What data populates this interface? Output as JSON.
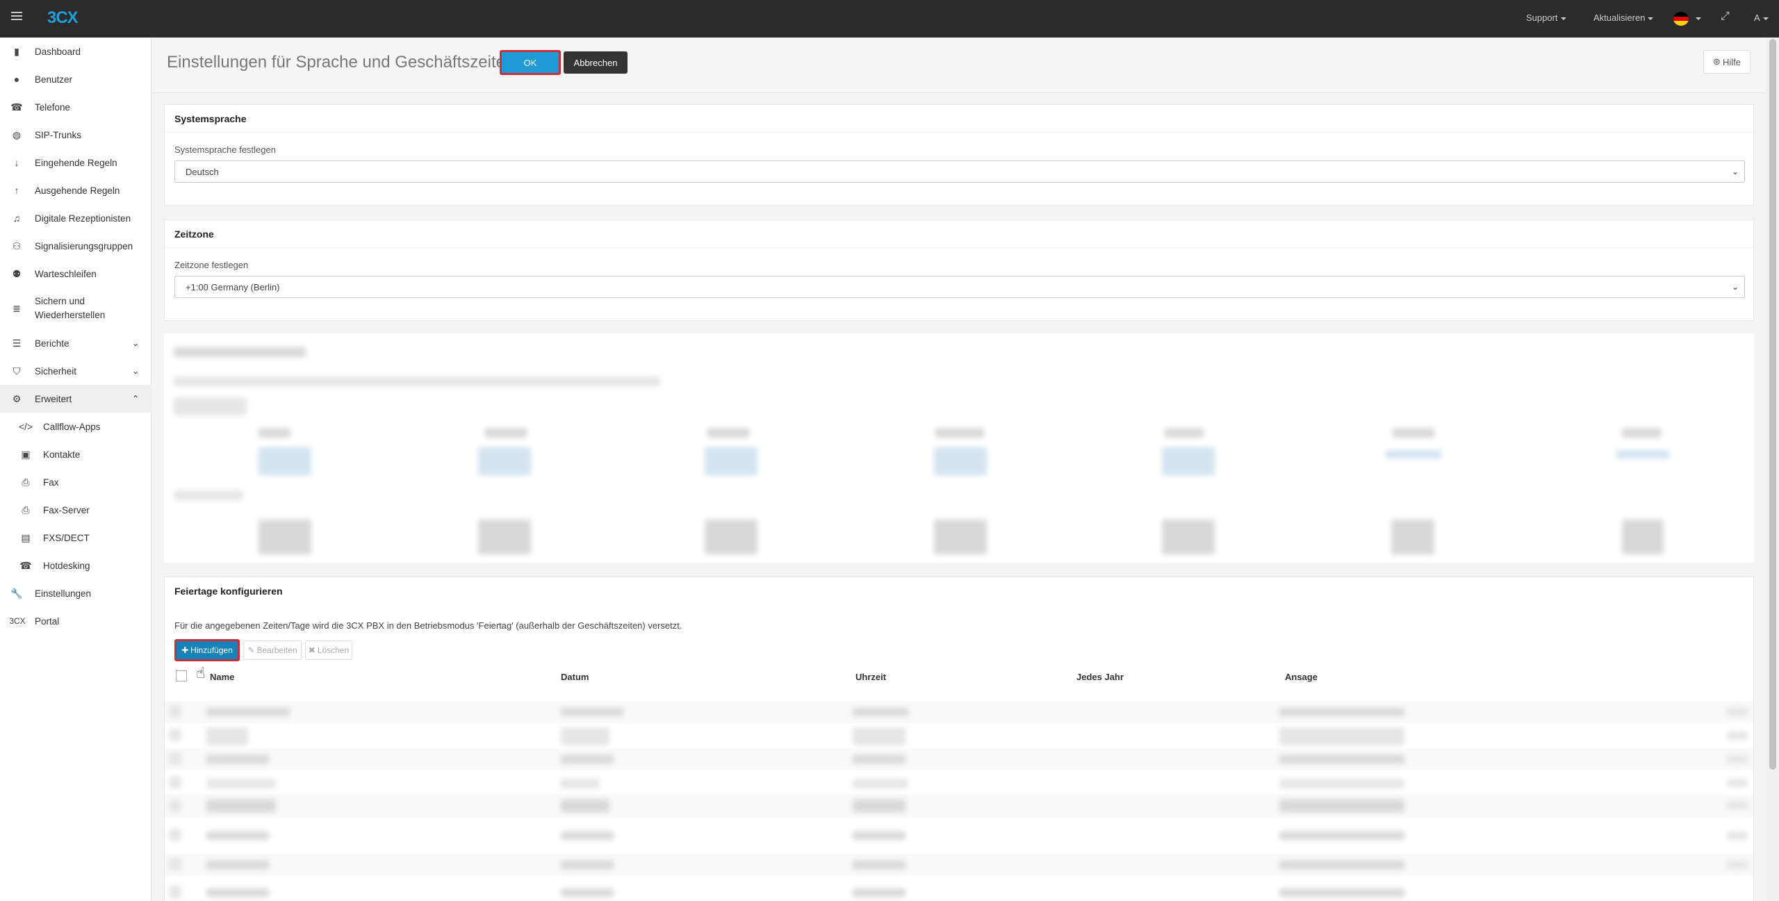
{
  "topbar": {
    "logo_main": "3CX",
    "support_label": "Support",
    "update_label": "Aktualisieren",
    "user_label": "A",
    "flag_colors": [
      "#000000",
      "#dd0000",
      "#ffce00"
    ]
  },
  "sidebar": {
    "items": [
      {
        "label": "Dashboard",
        "icon": "bar-chart-icon"
      },
      {
        "label": "Benutzer",
        "icon": "user-icon"
      },
      {
        "label": "Telefone",
        "icon": "phone-icon"
      },
      {
        "label": "SIP-Trunks",
        "icon": "globe-icon"
      },
      {
        "label": "Eingehende Regeln",
        "icon": "arrow-down-icon"
      },
      {
        "label": "Ausgehende Regeln",
        "icon": "arrow-up-icon"
      },
      {
        "label": "Digitale Rezeptionisten",
        "icon": "headset-icon"
      },
      {
        "label": "Signalisierungsgruppen",
        "icon": "group-icon"
      },
      {
        "label": "Warteschleifen",
        "icon": "queue-icon"
      },
      {
        "label": "Sichern und",
        "label2": "Wiederherstellen",
        "icon": "database-icon"
      },
      {
        "label": "Berichte",
        "icon": "list-icon"
      },
      {
        "label": "Sicherheit",
        "icon": "shield-icon"
      },
      {
        "label": "Erweitert",
        "icon": "cog-icon"
      },
      {
        "label": "Callflow-Apps",
        "icon": "code-icon"
      },
      {
        "label": "Kontakte",
        "icon": "contact-book-icon"
      },
      {
        "label": "Fax",
        "icon": "fax-icon"
      },
      {
        "label": "Fax-Server",
        "icon": "fax-server-icon"
      },
      {
        "label": "FXS/DECT",
        "icon": "device-icon"
      },
      {
        "label": "Hotdesking",
        "icon": "hotdesk-phone-icon"
      },
      {
        "label": "Einstellungen",
        "icon": "wrench-icon"
      },
      {
        "label": "Portal",
        "icon": "3cx-portal-icon",
        "icon_text": "3CX"
      }
    ]
  },
  "header": {
    "title": "Einstellungen für Sprache und Geschäftszeiten",
    "ok_label": "OK",
    "cancel_label": "Abbrechen",
    "help_label": "Hilfe"
  },
  "language": {
    "section_title": "Systemsprache",
    "field_label": "Systemsprache festlegen",
    "value": "Deutsch"
  },
  "timezone": {
    "section_title": "Zeitzone",
    "field_label": "Zeitzone festlegen",
    "value": "+1:00 Germany (Berlin)"
  },
  "holidays": {
    "section_title": "Feiertage konfigurieren",
    "description": "Für die angegebenen Zeiten/Tage wird die 3CX PBX in den Betriebsmodus 'Feiertag' (außerhalb der Geschäftszeiten) versetzt.",
    "add_label": "Hinzufügen",
    "edit_label": "Bearbeiten",
    "delete_label": "Löschen",
    "columns": [
      "Name",
      "Datum",
      "Uhrzeit",
      "Jedes Jahr",
      "Ansage"
    ]
  }
}
